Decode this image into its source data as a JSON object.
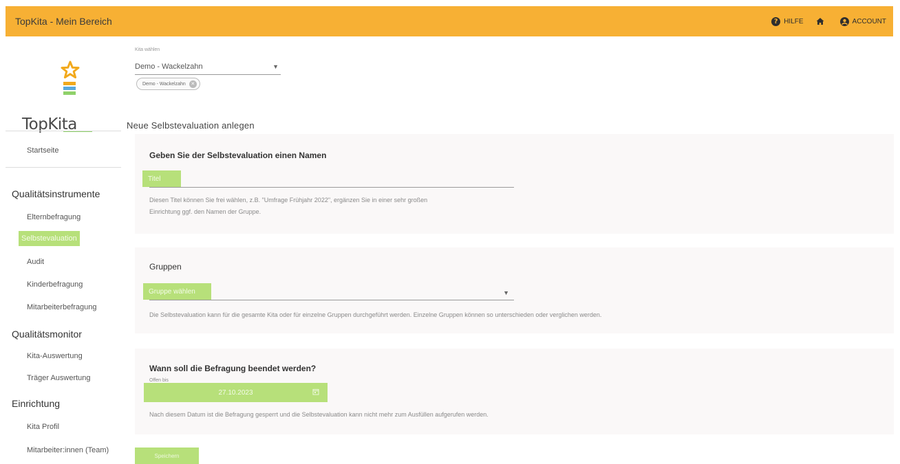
{
  "header": {
    "title": "TopKita - Mein Bereich",
    "help_label": "HILFE",
    "account_label": "ACCOUNT"
  },
  "logo": {
    "text": "TopKita"
  },
  "sidebar": {
    "home": "Startseite",
    "sections": [
      {
        "title": "Qualitätsinstrumente",
        "items": [
          "Elternbefragung",
          "Selbstevaluation",
          "Audit",
          "Kinderbefragung",
          "Mitarbeiterbefragung"
        ]
      },
      {
        "title": "Qualitätsmonitor",
        "items": [
          "Kita-Auswertung",
          "Träger Auswertung"
        ]
      },
      {
        "title": "Einrichtung",
        "items": [
          "Kita Profil",
          "Mitarbeiter:innen (Team)"
        ]
      }
    ],
    "active_item": "Selbstevaluation"
  },
  "kita": {
    "label": "Kita wählen",
    "selected": "Demo - Wackelzahn",
    "chip": "Demo - Wackelzahn"
  },
  "page": {
    "heading": "Neue Selbstevaluation anlegen"
  },
  "name_card": {
    "title": "Geben Sie der Selbstevaluation einen Namen",
    "placeholder": "Titel",
    "help_line1": "Diesen Titel können Sie frei wählen, z.B. \"Umfrage Frühjahr 2022\", ergänzen Sie in einer sehr großen",
    "help_line2": "Einrichtung ggf. den Namen der Gruppe."
  },
  "groups_card": {
    "title": "Gruppen",
    "placeholder": "Gruppe wählen",
    "help": "Die Selbstevaluation kann für die gesamte Kita oder für einzelne Gruppen durchgeführt werden. Einzelne Gruppen können so unterschieden oder verglichen werden."
  },
  "end_card": {
    "title": "Wann soll die Befragung beendet werden?",
    "label": "Offen bis",
    "date": "27.10.2023",
    "help": "Nach diesem Datum ist die Befragung gesperrt und die Selbstevaluation kann nicht mehr zum Ausfüllen aufgerufen werden."
  },
  "actions": {
    "save_label": "Speichern"
  },
  "colors": {
    "accent": "#f7b034",
    "highlight": "#b7e07a",
    "card_bg": "#faf8f8"
  }
}
